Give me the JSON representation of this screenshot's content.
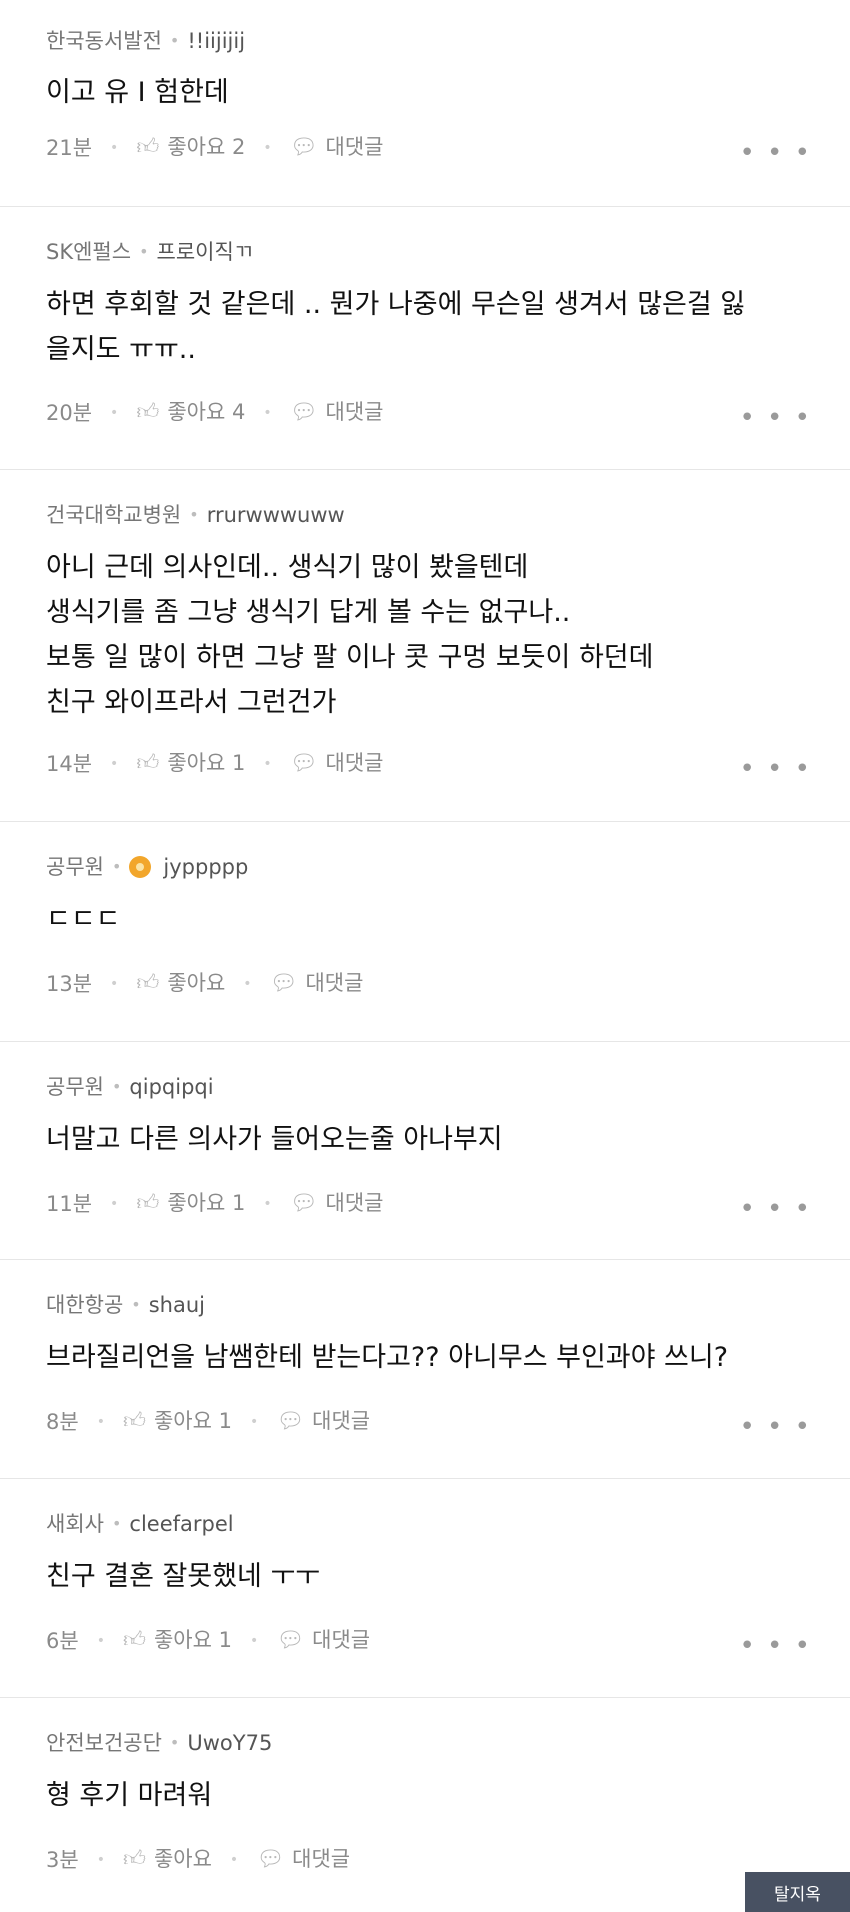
{
  "comments": [
    {
      "company": "한국동서발전",
      "nick": "!!iijijij",
      "body": "이고 유 I 험한데",
      "time": "21분",
      "like": "좋아요 2",
      "reply": "대댓글"
    },
    {
      "company": "SK엔펄스",
      "nick": "프로이직ㄲ",
      "body": "하면 후회할 것 같은데 .. 뭔가 나중에 무슨일 생겨서 많은걸 잃\n을지도 ㅠㅠ..",
      "time": "20분",
      "like": "좋아요 4",
      "reply": "대댓글"
    },
    {
      "company": "건국대학교병원",
      "nick": "rrurwwwuww",
      "body": "아니 근데 의사인데.. 생식기 많이 봤을텐데\n생식기를 좀 그냥 생식기 답게 볼 수는 없구나..\n보통 일 많이 하면 그냥 팔 이나 콧 구멍 보듯이 하던데\n친구 와이프라서 그런건가",
      "time": "14분",
      "like": "좋아요 1",
      "reply": "대댓글"
    },
    {
      "company": "공무원",
      "nick": "jyppppp",
      "body": "ㄷㄷㄷ",
      "time": "13분",
      "like": "좋아요",
      "reply": "대댓글"
    },
    {
      "company": "공무원",
      "nick": "qipqipqi",
      "body": "너말고 다른 의사가 들어오는줄 아나부지",
      "time": "11분",
      "like": "좋아요 1",
      "reply": "대댓글"
    },
    {
      "company": "대한항공",
      "nick": "shauj",
      "body": "브라질리언을 남쌤한테 받는다고?? 아니무스 부인과야 쓰니?",
      "time": "8분",
      "like": "좋아요 1",
      "reply": "대댓글"
    },
    {
      "company": "새회사",
      "nick": "cleefarpel",
      "body": "친구 결혼 잘못했네 ㅜㅜ",
      "time": "6분",
      "like": "좋아요 1",
      "reply": "대댓글"
    },
    {
      "company": "안전보건공단",
      "nick": "UwoY75",
      "body": "형 후기 마려워",
      "time": "3분",
      "like": "좋아요",
      "reply": "대댓글"
    }
  ],
  "icons": {
    "like": "thumbs-up-icon",
    "reply": "speech-bubble-icon",
    "more": "more-dots-icon"
  },
  "more_glyph": "• • •",
  "watermark": "탈지옥"
}
